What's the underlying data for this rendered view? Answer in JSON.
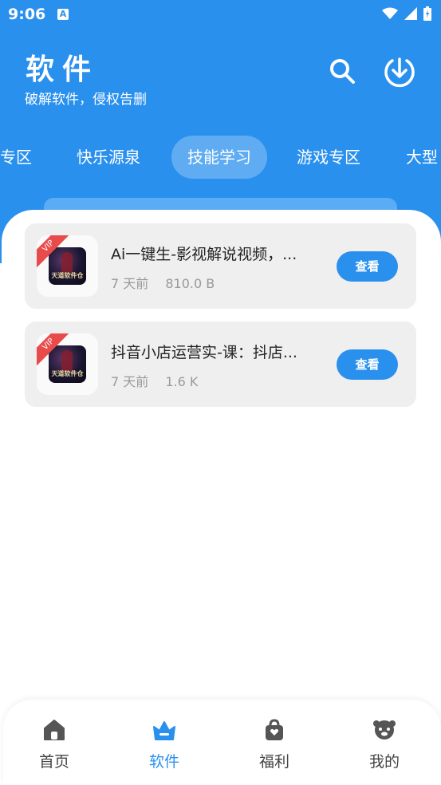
{
  "status_bar": {
    "time": "9:06",
    "notification_icon": "A"
  },
  "header": {
    "title": "软件",
    "subtitle": "破解软件，侵权告删"
  },
  "tabs": [
    {
      "label": "专区"
    },
    {
      "label": "快乐源泉"
    },
    {
      "label": "技能学习",
      "active": true
    },
    {
      "label": "游戏专区"
    },
    {
      "label": "大型"
    }
  ],
  "items": [
    {
      "title": "Ai一键生-影视解说视频，...",
      "age": "7 天前",
      "size": "810.0 B",
      "badge": "VIP",
      "thumb_caption": "天道软件仓",
      "action": "查看"
    },
    {
      "title": "抖音小店运营实-课：抖店...",
      "age": "7 天前",
      "size": "1.6 K",
      "badge": "VIP",
      "thumb_caption": "天道软件仓",
      "action": "查看"
    }
  ],
  "bottom_nav": [
    {
      "label": "首页",
      "icon": "home-icon"
    },
    {
      "label": "软件",
      "icon": "crown-icon",
      "active": true
    },
    {
      "label": "福利",
      "icon": "bag-icon"
    },
    {
      "label": "我的",
      "icon": "profile-icon"
    }
  ],
  "colors": {
    "primary": "#2a90ee",
    "vip": "#e94a4a",
    "card_bg": "#efefef"
  }
}
